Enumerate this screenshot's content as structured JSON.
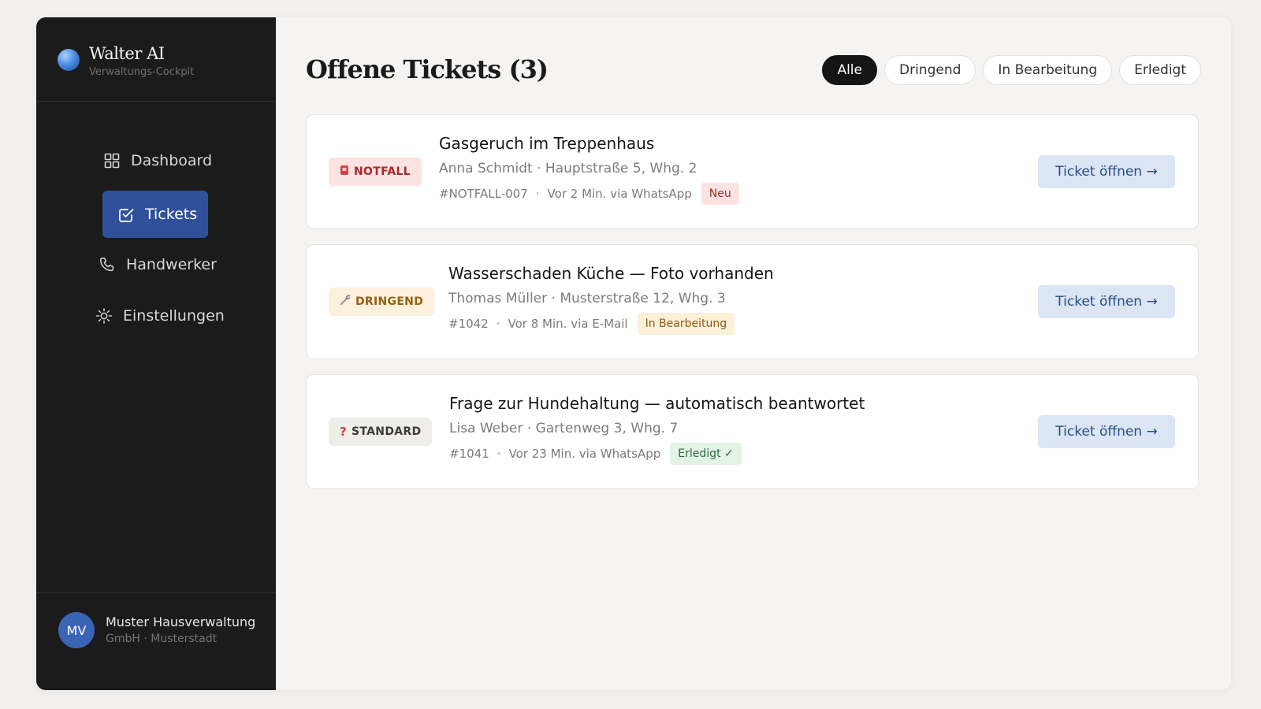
{
  "brand": {
    "title": "Walter AI",
    "subtitle": "Verwaltungs-Cockpit"
  },
  "nav": [
    {
      "label": "Dashboard",
      "icon": "grid-icon",
      "active": false
    },
    {
      "label": "Tickets",
      "icon": "check-square-icon",
      "active": true
    },
    {
      "label": "Handwerker",
      "icon": "phone-icon",
      "active": false
    },
    {
      "label": "Einstellungen",
      "icon": "sun-gear-icon",
      "active": false
    }
  ],
  "account": {
    "initials": "MV",
    "name": "Muster Hausverwaltung",
    "sub": "GmbH · Musterstadt"
  },
  "header": {
    "title": "Offene Tickets (3)"
  },
  "filters": [
    "Alle",
    "Dringend",
    "In Bearbeitung",
    "Erledigt"
  ],
  "active_filter": "Alle",
  "tickets": [
    {
      "priority": "NOTFALL",
      "priority_icon": "alarm-icon",
      "title": "Gasgeruch im Treppenhaus",
      "meta": "Anna Schmidt · Hauptstraße 5, Whg. 2",
      "id": "#NOTFALL-007",
      "time": "Vor 2 Min. via WhatsApp",
      "status": "Neu",
      "button": "Ticket öffnen →"
    },
    {
      "priority": "DRINGEND",
      "priority_icon": "wrench-icon",
      "title": "Wasserschaden Küche — Foto vorhanden",
      "meta": "Thomas Müller · Musterstraße 12, Whg. 3",
      "id": "#1042",
      "time": "Vor 8 Min. via E-Mail",
      "status": "In Bearbeitung",
      "button": "Ticket öffnen →"
    },
    {
      "priority": "STANDARD",
      "priority_icon": "question-icon",
      "title": "Frage zur Hundehaltung — automatisch beantwortet",
      "meta": "Lisa Weber · Gartenweg 3, Whg. 7",
      "id": "#1041",
      "time": "Vor 23 Min. via WhatsApp",
      "status": "Erledigt ✓",
      "button": "Ticket öffnen →"
    }
  ],
  "colors": {
    "sidebar": "#1b1b1b",
    "accent": "#30509a",
    "notfall": "#a82a2a",
    "dringend": "#946215",
    "erledigt": "#2e6b3b"
  }
}
